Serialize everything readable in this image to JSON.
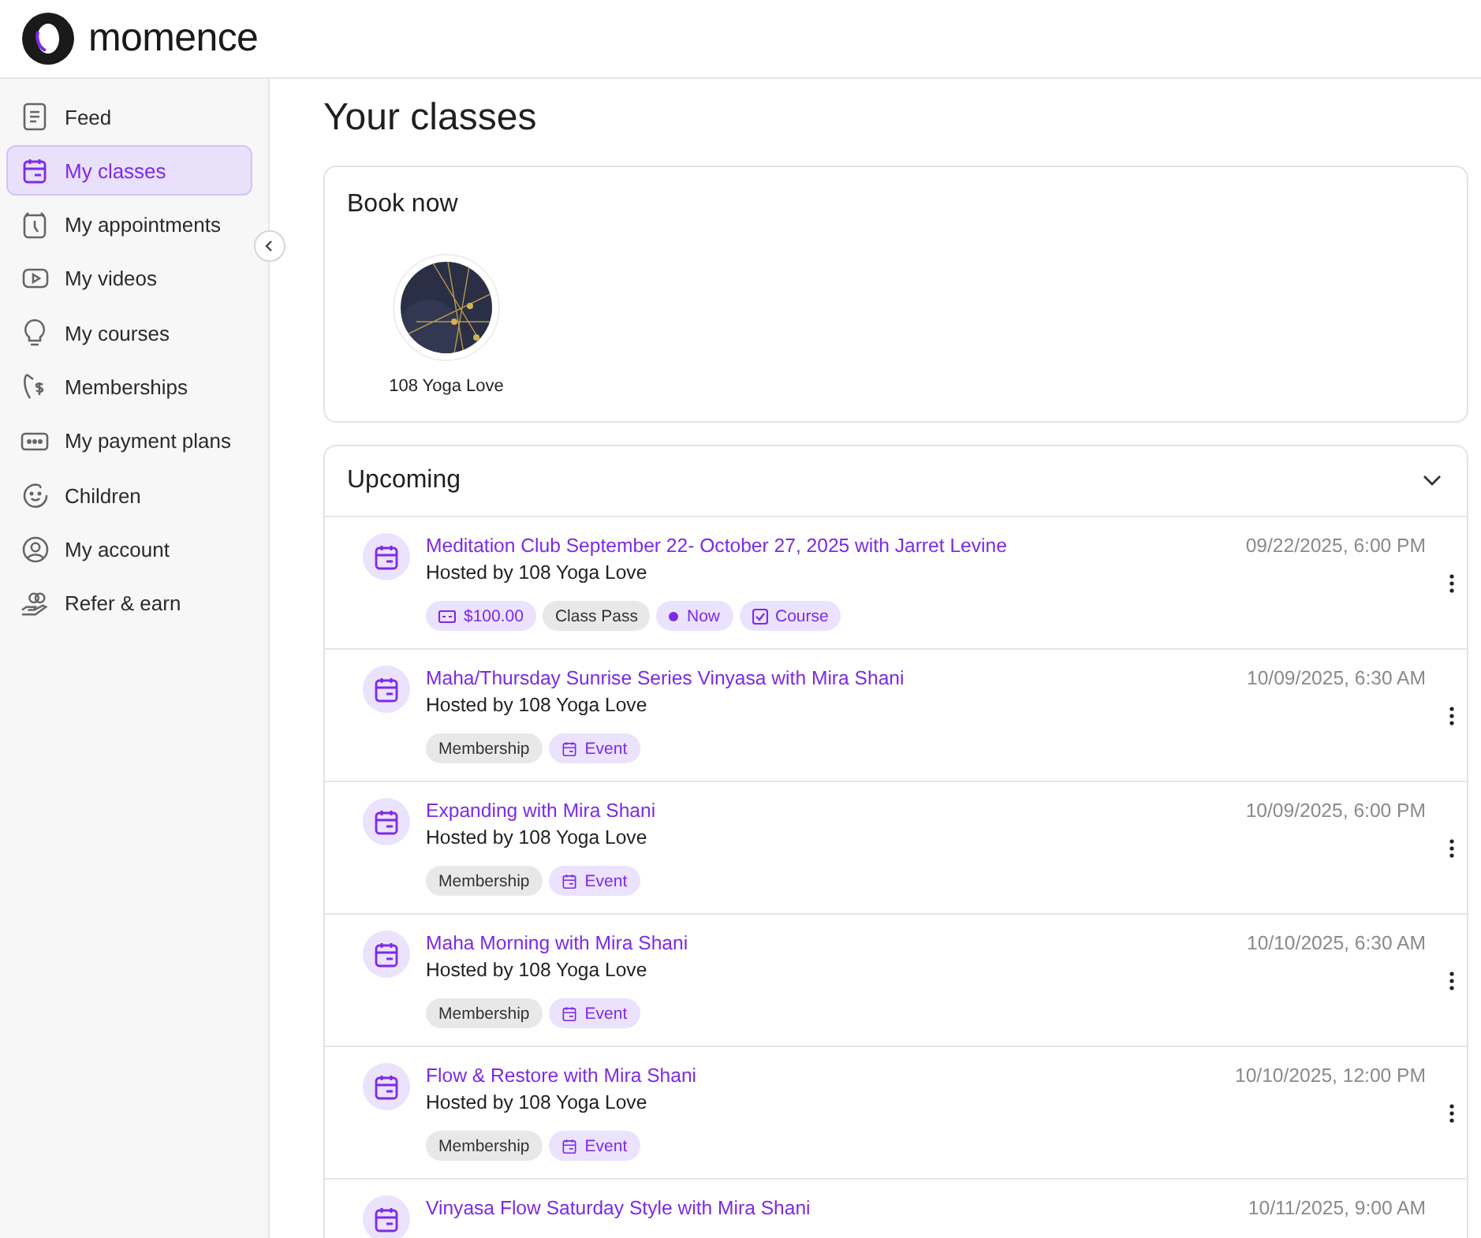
{
  "brand": {
    "name": "momence"
  },
  "sidebar": {
    "items": [
      {
        "label": "Feed",
        "selected": false
      },
      {
        "label": "My classes",
        "selected": true
      },
      {
        "label": "My appointments",
        "selected": false
      },
      {
        "label": "My videos",
        "selected": false
      },
      {
        "label": "My courses",
        "selected": false
      },
      {
        "label": "Memberships",
        "selected": false
      },
      {
        "label": "My payment plans",
        "selected": false
      },
      {
        "label": "Children",
        "selected": false
      },
      {
        "label": "My account",
        "selected": false
      },
      {
        "label": "Refer & earn",
        "selected": false
      }
    ]
  },
  "page": {
    "title": "Your classes"
  },
  "book_now": {
    "title": "Book now",
    "hosts": [
      {
        "name": "108 Yoga Love",
        "kind": "picture"
      }
    ]
  },
  "upcoming": {
    "title": "Upcoming",
    "expanded": true,
    "events": [
      {
        "title": "Meditation Club September 22- October 27, 2025 with Jarret Levine",
        "host": "Hosted by 108 Yoga Love",
        "date": "09/22/2025, 6:00 PM",
        "tags": [
          {
            "kind": "price",
            "label": "$100.00"
          },
          {
            "kind": "plain",
            "label": "Class Pass"
          },
          {
            "kind": "now",
            "label": "Now"
          },
          {
            "kind": "course",
            "label": "Course"
          }
        ]
      },
      {
        "title": "Maha/Thursday Sunrise Series Vinyasa with Mira Shani",
        "host": "Hosted by 108 Yoga Love",
        "date": "10/09/2025, 6:30 AM",
        "tags": [
          {
            "kind": "plain",
            "label": "Membership"
          },
          {
            "kind": "event",
            "label": "Event"
          }
        ]
      },
      {
        "title": "Expanding with Mira Shani",
        "host": "Hosted by 108 Yoga Love",
        "date": "10/09/2025, 6:00 PM",
        "tags": [
          {
            "kind": "plain",
            "label": "Membership"
          },
          {
            "kind": "event",
            "label": "Event"
          }
        ]
      },
      {
        "title": "Maha Morning with Mira Shani",
        "host": "Hosted by 108 Yoga Love",
        "date": "10/10/2025, 6:30 AM",
        "tags": [
          {
            "kind": "plain",
            "label": "Membership"
          },
          {
            "kind": "event",
            "label": "Event"
          }
        ]
      },
      {
        "title": "Flow & Restore with Mira Shani",
        "host": "Hosted by 108 Yoga Love",
        "date": "10/10/2025, 12:00 PM",
        "tags": [
          {
            "kind": "plain",
            "label": "Membership"
          },
          {
            "kind": "event",
            "label": "Event"
          }
        ]
      },
      {
        "title": "Vinyasa Flow Saturday Style with Mira Shani",
        "date": "10/11/2025, 9:00 AM"
      }
    ]
  }
}
